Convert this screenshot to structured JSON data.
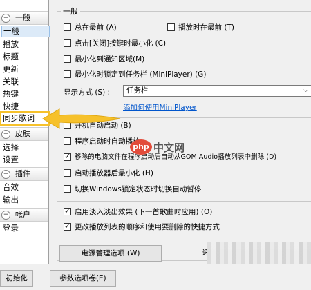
{
  "sidebar": {
    "group_general": "一般",
    "items_general": [
      "一般",
      "播放",
      "标题",
      "更新",
      "关联",
      "热键",
      "快捷"
    ],
    "highlighted_item": "同步歌词",
    "group_skin": "皮肤",
    "items_skin": [
      "选择",
      "设置"
    ],
    "group_plugins": "插件",
    "items_plugins": [
      "音效",
      "输出"
    ],
    "group_account": "帐户",
    "items_account": [
      "登录"
    ]
  },
  "main": {
    "group_title": "一般",
    "cb_always_on_top": "总在最前 (A)",
    "cb_top_when_playing": "播放时在最前 (T)",
    "cb_close_minimize": "点击[关闭]按键时最小化 (C)",
    "cb_minimize_tray": "最小化到通知区域(M)",
    "cb_minimize_taskbar": "最小化时锁定到任务栏 (MiniPlayer) (G)",
    "display_mode_label": "显示方式 (S) :",
    "display_mode_value": "任务栏",
    "miniplayer_link": "添加何使用MiniPlayer",
    "cb_autostart": "开机自动启动 (B)",
    "cb_autoplay": "程序启动时自动播放",
    "cb_remove_deleted": "移除的电脑文件在程序启动后自动从GOM Audio播放列表中删除 (D)",
    "cb_minimize_on_start": "启动播放器后最小化 (H)",
    "cb_pause_on_lock": "切换Windows锁定状态时切换自动暂停",
    "cb_fade": "启用淡入淡出效果 (下一首歌曲时应用) (O)",
    "cb_change_shortcut": "更改播放列表的顺序和使用要删除的快捷方式",
    "btn_power": "电源管理选项 (W)",
    "btn_power_right": "递"
  },
  "footer": {
    "btn_init": "初始化",
    "btn_options": "参数选项卷(E)"
  },
  "checks": {
    "always_on_top": false,
    "top_when_playing": false,
    "close_minimize": false,
    "minimize_tray": false,
    "minimize_taskbar": false,
    "autostart": false,
    "autoplay": false,
    "remove_deleted": true,
    "minimize_on_start": false,
    "pause_on_lock": false,
    "fade": true,
    "change_shortcut": true
  },
  "watermark": {
    "logo": "php",
    "text": "中文网"
  },
  "colors": {
    "highlight": "#f6c12b",
    "link": "#0055cc",
    "selected_bg": "#dceaf8"
  }
}
